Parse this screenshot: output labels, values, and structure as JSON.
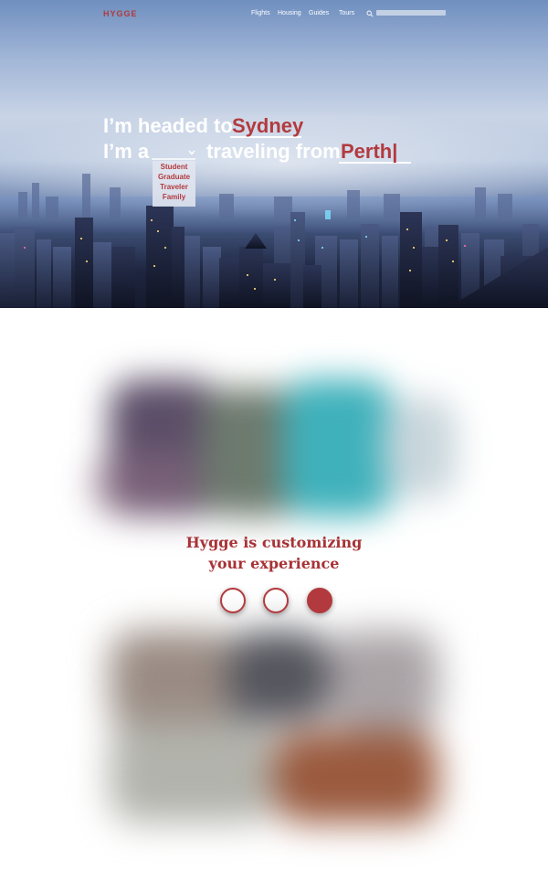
{
  "header": {
    "logo": "HYGGE",
    "nav": [
      "Flights",
      "Housing",
      "Guides",
      "Tours"
    ],
    "search": {
      "placeholder": "",
      "icon": "search-icon"
    }
  },
  "hero": {
    "line1_prefix": "I’m headed to",
    "destination": "Sydney",
    "line2_prefix": "I’m a",
    "line2_middle": "traveling from",
    "origin": "Perth|",
    "traveler_options": [
      "Student",
      "Graduate",
      "Traveler",
      "Family"
    ]
  },
  "loading": {
    "title_line1": "Hygge is customizing",
    "title_line2": "your experience",
    "steps_total": 3,
    "active_step": 3
  },
  "colors": {
    "accent": "#b23a3e",
    "text_light": "#ffffff"
  }
}
